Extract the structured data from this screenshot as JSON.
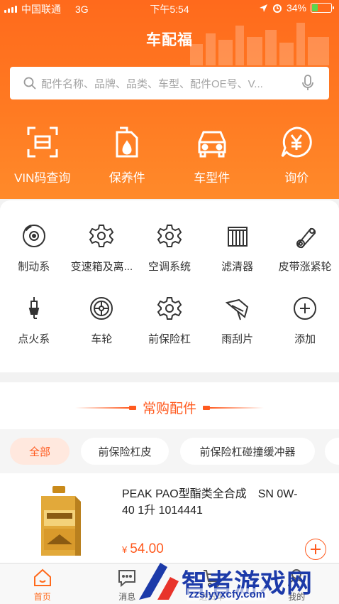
{
  "statusbar": {
    "carrier": "中国联通",
    "network": "3G",
    "time": "下午5:54",
    "battery": "34%",
    "battery_level": 0.34
  },
  "app": {
    "title": "车配福"
  },
  "search": {
    "placeholder": "配件名称、品牌、品类、车型、配件OE号、V..."
  },
  "quick_actions": [
    {
      "label": "VIN码查询",
      "icon": "scan-frame-icon"
    },
    {
      "label": "保养件",
      "icon": "oil-can-icon"
    },
    {
      "label": "车型件",
      "icon": "car-icon"
    },
    {
      "label": "询价",
      "icon": "yen-bubble-icon"
    }
  ],
  "categories": [
    {
      "label": "制动系",
      "icon": "brake-disc-icon"
    },
    {
      "label": "变速箱及离...",
      "icon": "gear-icon"
    },
    {
      "label": "空调系统",
      "icon": "gear-icon"
    },
    {
      "label": "滤清器",
      "icon": "filter-icon"
    },
    {
      "label": "皮带涨紧轮",
      "icon": "belt-tensioner-icon"
    },
    {
      "label": "点火系",
      "icon": "spark-plug-icon"
    },
    {
      "label": "车轮",
      "icon": "wheel-icon"
    },
    {
      "label": "前保险杠",
      "icon": "gear-icon"
    },
    {
      "label": "雨刮片",
      "icon": "wiper-icon"
    },
    {
      "label": "添加",
      "icon": "plus-circle-icon"
    }
  ],
  "section": {
    "title": "常购配件"
  },
  "filter_tabs": [
    {
      "label": "全部",
      "active": true
    },
    {
      "label": "前保险杠皮",
      "active": false
    },
    {
      "label": "前保险杠碰撞缓冲器",
      "active": false
    }
  ],
  "product": {
    "name": "PEAK PAO型酯类全合成　SN 0W-40 1升 1014441",
    "currency": "¥",
    "price": "54.00"
  },
  "tabbar": [
    {
      "label": "首页",
      "icon": "home-icon",
      "active": true
    },
    {
      "label": "消息",
      "icon": "message-icon",
      "active": false
    },
    {
      "label": "进货单",
      "icon": "cart-icon",
      "active": false
    },
    {
      "label": "我的",
      "icon": "user-icon",
      "active": false
    }
  ],
  "watermark": {
    "text": "智者游戏网",
    "url": "zzslyyxcfy.com"
  },
  "colors": {
    "brand": "#ff6a1c",
    "accent": "#ff5a1f"
  }
}
